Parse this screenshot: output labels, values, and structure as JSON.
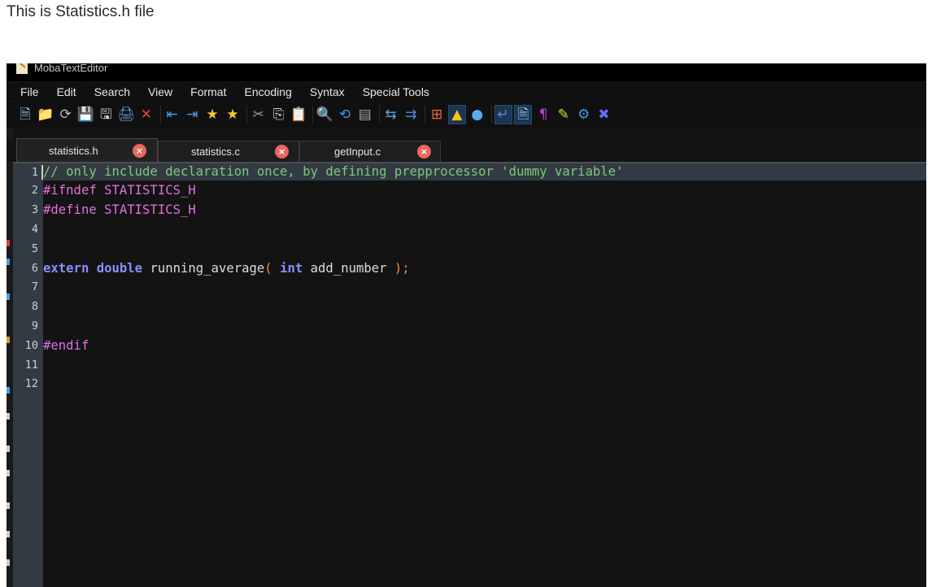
{
  "caption": "This is Statistics.h file",
  "window": {
    "title": "MobaTextEditor"
  },
  "menu": [
    "File",
    "Edit",
    "Search",
    "View",
    "Format",
    "Encoding",
    "Syntax",
    "Special Tools"
  ],
  "toolbar": [
    {
      "icon": "new-file-icon",
      "glyph": "🗎",
      "color": "#9fd3ff"
    },
    {
      "icon": "open-folder-icon",
      "glyph": "📁",
      "color": "#f4b23a"
    },
    {
      "icon": "reload-icon",
      "glyph": "⟳",
      "color": "#bbbbbb"
    },
    {
      "icon": "save-icon",
      "glyph": "💾",
      "color": "#dddddd"
    },
    {
      "icon": "save-all-icon",
      "glyph": "🖫",
      "color": "#dddddd"
    },
    {
      "icon": "print-icon",
      "glyph": "🖨",
      "color": "#6aa9e8"
    },
    {
      "icon": "close-icon",
      "glyph": "✕",
      "color": "#e84040"
    },
    {
      "sep": true
    },
    {
      "icon": "unindent-icon",
      "glyph": "⇤",
      "color": "#4aa0e8"
    },
    {
      "icon": "indent-icon",
      "glyph": "⇥",
      "color": "#4aa0e8"
    },
    {
      "icon": "bookmark-icon",
      "glyph": "★",
      "color": "#f2c93a"
    },
    {
      "icon": "bookmark-add-icon",
      "glyph": "★",
      "color": "#f2c93a"
    },
    {
      "sep": true
    },
    {
      "icon": "cut-icon",
      "glyph": "✂",
      "color": "#9a9a9a"
    },
    {
      "icon": "copy-icon",
      "glyph": "⎘",
      "color": "#cccccc"
    },
    {
      "icon": "paste-icon",
      "glyph": "📋",
      "color": "#cccccc"
    },
    {
      "sep": true
    },
    {
      "icon": "search-icon",
      "glyph": "🔍",
      "color": "#5aa8f0"
    },
    {
      "icon": "replace-icon",
      "glyph": "⟲",
      "color": "#4a90e0"
    },
    {
      "icon": "goto-icon",
      "glyph": "▤",
      "color": "#aaaaaa"
    },
    {
      "sep": true
    },
    {
      "icon": "compare-icon",
      "glyph": "⇆",
      "color": "#5aa8f0"
    },
    {
      "icon": "merge-icon",
      "glyph": "⇉",
      "color": "#4a90e0"
    },
    {
      "sep": true
    },
    {
      "icon": "windows-eol-icon",
      "glyph": "⊞",
      "color": "#f06a3a"
    },
    {
      "icon": "linux-eol-icon",
      "glyph": "▲",
      "color": "#f0c020",
      "active": true
    },
    {
      "icon": "mac-eol-icon",
      "glyph": "●",
      "color": "#5aa8f0"
    },
    {
      "sep": true
    },
    {
      "icon": "word-wrap-icon",
      "glyph": "↵",
      "color": "#4a90e0",
      "active": true
    },
    {
      "icon": "edit-document-icon",
      "glyph": "🗎",
      "color": "#9fd3ff",
      "active": true
    },
    {
      "icon": "pilcrow-icon",
      "glyph": "¶",
      "color": "#b040d0"
    },
    {
      "icon": "highlighter-icon",
      "glyph": "✎",
      "color": "#c8e040"
    },
    {
      "icon": "settings-icon",
      "glyph": "⚙",
      "color": "#4a90e0"
    },
    {
      "icon": "exit-icon",
      "glyph": "✖",
      "color": "#6a6aff"
    }
  ],
  "tabs": [
    {
      "label": "statistics.h",
      "active": true
    },
    {
      "label": "statistics.c",
      "active": false
    },
    {
      "label": "getInput.c",
      "active": false
    }
  ],
  "tab_close_glyph": "×",
  "code_lines": [
    {
      "n": "1",
      "tokens": [
        {
          "t": "comment",
          "v": "// only include declaration once, by defining prepprocessor 'dummy variable'"
        }
      ]
    },
    {
      "n": "2",
      "tokens": [
        {
          "t": "preproc",
          "v": "#ifndef STATISTICS_H"
        }
      ]
    },
    {
      "n": "3",
      "tokens": [
        {
          "t": "preproc",
          "v": "#define STATISTICS_H"
        }
      ]
    },
    {
      "n": "4",
      "tokens": []
    },
    {
      "n": "5",
      "tokens": []
    },
    {
      "n": "6",
      "tokens": [
        {
          "t": "keyword",
          "v": "extern"
        },
        {
          "t": "plain",
          "v": " "
        },
        {
          "t": "keyword",
          "v": "double"
        },
        {
          "t": "plain",
          "v": " running_average"
        },
        {
          "t": "paren",
          "v": "("
        },
        {
          "t": "plain",
          "v": " "
        },
        {
          "t": "keyword",
          "v": "int"
        },
        {
          "t": "plain",
          "v": " add_number "
        },
        {
          "t": "paren",
          "v": ");"
        }
      ]
    },
    {
      "n": "7",
      "tokens": []
    },
    {
      "n": "8",
      "tokens": []
    },
    {
      "n": "9",
      "tokens": []
    },
    {
      "n": "10",
      "tokens": [
        {
          "t": "preproc",
          "v": "#endif"
        }
      ]
    },
    {
      "n": "11",
      "tokens": []
    },
    {
      "n": "12",
      "tokens": []
    }
  ],
  "current_line": 1
}
